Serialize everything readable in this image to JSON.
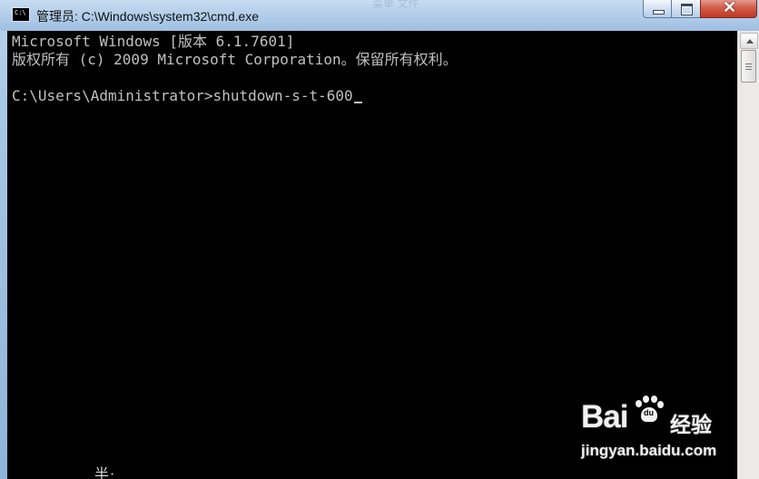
{
  "window": {
    "title": "管理员: C:\\Windows\\system32\\cmd.exe",
    "background_hint": "菜单 文件",
    "close_glyph": "✕"
  },
  "console": {
    "lines": [
      "Microsoft Windows [版本 6.1.7601]",
      "版权所有 (c) 2009 Microsoft Corporation。保留所有权利。",
      "C:\\Users\\Administrator>shutdown-s-t-600"
    ],
    "bottom_fragment": "半·"
  },
  "watermark": {
    "brand": "Bai",
    "paw_text": "du",
    "product": "经验",
    "url": "jingyan.baidu.com"
  },
  "colors": {
    "console_background": "#000000",
    "console_text": "#c0c0c0",
    "title_bar": "#b4cfea",
    "close_button": "#c74a33"
  },
  "icons": {
    "app_icon": "cmd-icon",
    "minimize": "minimize-icon",
    "maximize": "maximize-icon",
    "close": "close-icon",
    "scroll_up": "chevron-up-icon"
  }
}
